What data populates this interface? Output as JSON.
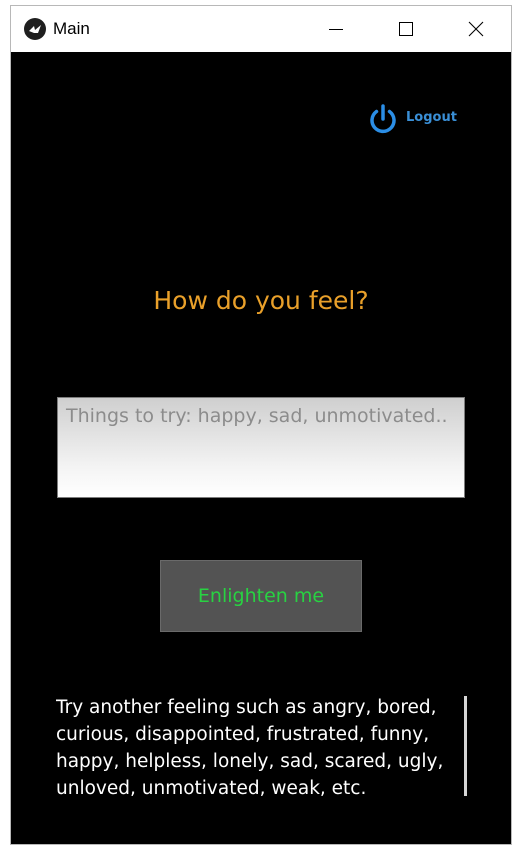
{
  "window": {
    "title": "Main"
  },
  "header": {
    "logout_label": "Logout"
  },
  "main": {
    "headline": "How do you feel?",
    "feeling_input": {
      "placeholder": "Things to try: happy, sad, unmotivated..",
      "value": ""
    },
    "enlighten_button": "Enlighten me",
    "hint": "Try another feeling such as angry, bored, curious, disappointed, frustrated, funny, happy, helpless, lonely, sad, scared, ugly, unloved, unmotivated, weak, etc."
  },
  "colors": {
    "background": "#000000",
    "headline": "#e9a02a",
    "button_text": "#28d242",
    "logout": "#3a8fd6"
  },
  "icons": {
    "app": "kivy-logo-icon",
    "logout": "power-icon"
  }
}
